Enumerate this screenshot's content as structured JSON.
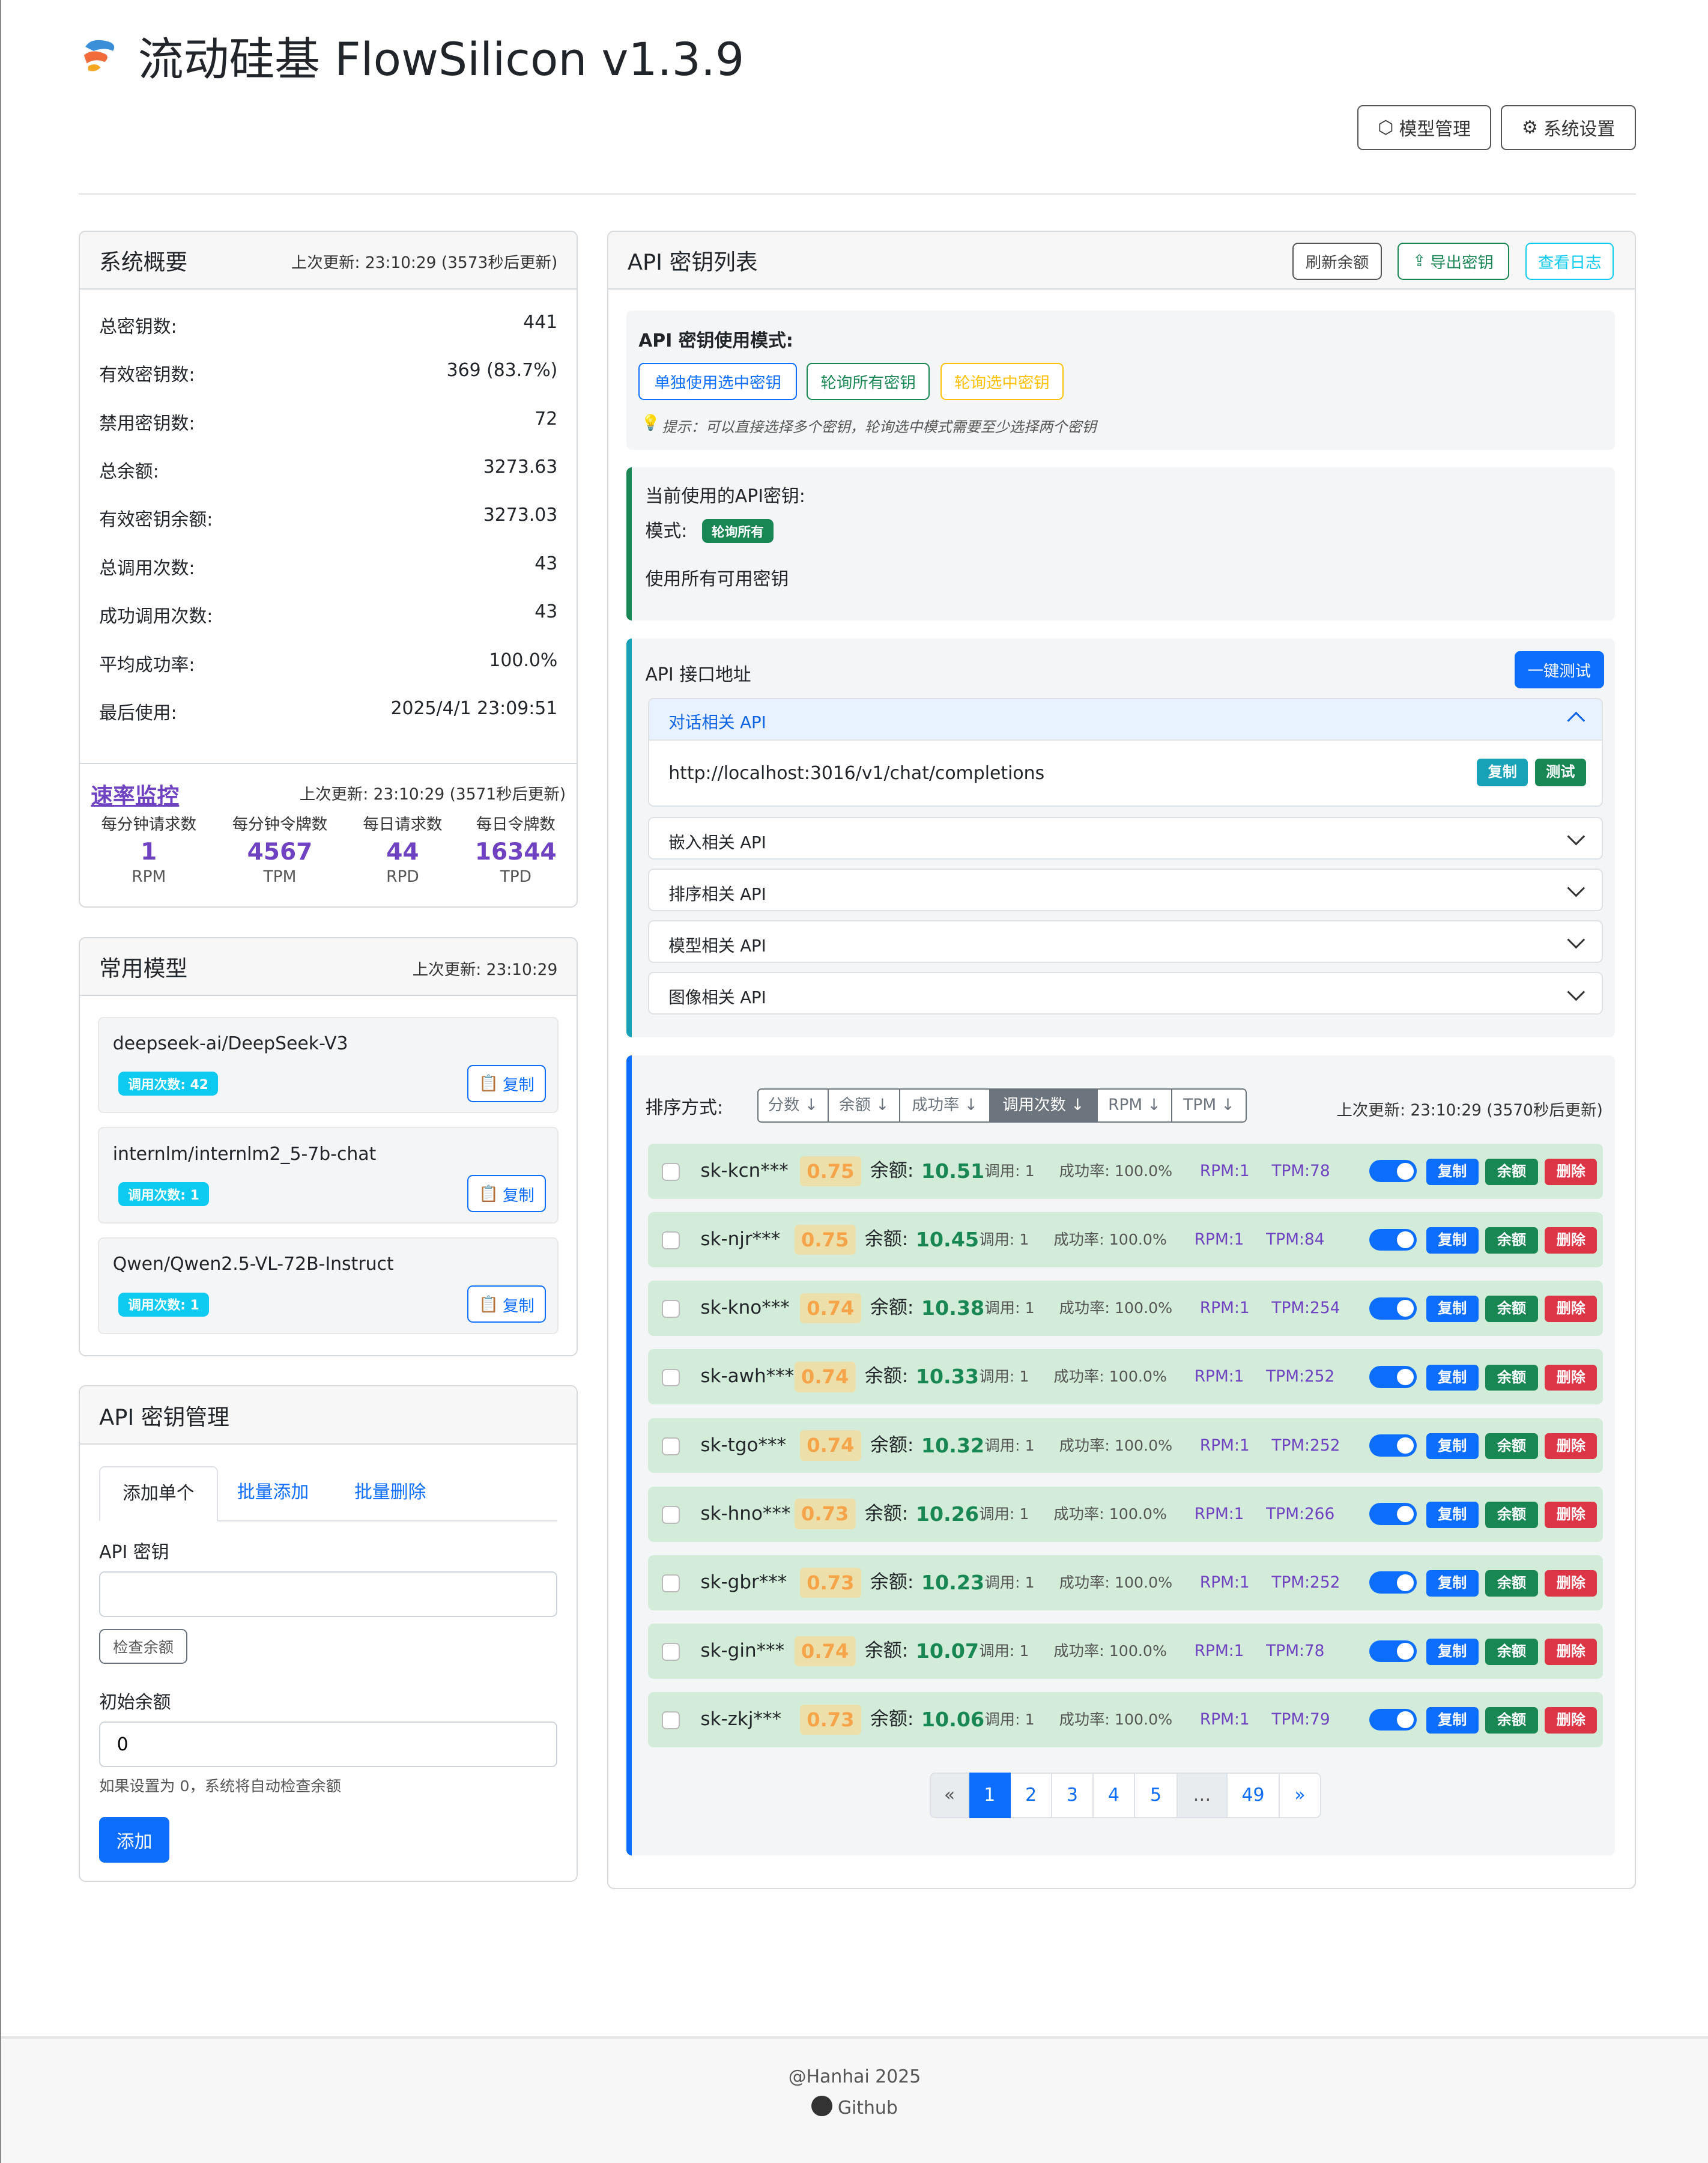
{
  "app": {
    "title": "流动硅基 FlowSilicon v1.3.9",
    "buttons": {
      "models": "模型管理",
      "settings": "系统设置"
    }
  },
  "overview": {
    "title": "系统概要",
    "updated": "上次更新: 23:10:29 (3573秒后更新)",
    "stats": [
      {
        "label": "总密钥数:",
        "value": "441"
      },
      {
        "label": "有效密钥数:",
        "value": "369 (83.7%)"
      },
      {
        "label": "禁用密钥数:",
        "value": "72"
      },
      {
        "label": "总余额:",
        "value": "3273.63"
      },
      {
        "label": "有效密钥余额:",
        "value": "3273.03"
      },
      {
        "label": "总调用次数:",
        "value": "43"
      },
      {
        "label": "成功调用次数:",
        "value": "43"
      },
      {
        "label": "平均成功率:",
        "value": "100.0%"
      },
      {
        "label": "最后使用:",
        "value": "2025/4/1 23:09:51"
      }
    ],
    "rate": {
      "title": "速率监控",
      "updated": "上次更新: 23:10:29 (3571秒后更新)",
      "items": [
        {
          "label": "每分钟请求数",
          "value": "1",
          "unit": "RPM"
        },
        {
          "label": "每分钟令牌数",
          "value": "4567",
          "unit": "TPM"
        },
        {
          "label": "每日请求数",
          "value": "44",
          "unit": "RPD"
        },
        {
          "label": "每日令牌数",
          "value": "16344",
          "unit": "TPD"
        }
      ]
    }
  },
  "models": {
    "title": "常用模型",
    "updated": "上次更新: 23:10:29",
    "copy": "复制",
    "items": [
      {
        "name": "deepseek-ai/DeepSeek-V3",
        "count": "调用次数: 42"
      },
      {
        "name": "internlm/internlm2_5-7b-chat",
        "count": "调用次数: 1"
      },
      {
        "name": "Qwen/Qwen2.5-VL-72B-Instruct",
        "count": "调用次数: 1"
      }
    ]
  },
  "keymgmt": {
    "title": "API 密钥管理",
    "tabs": [
      "添加单个",
      "批量添加",
      "批量删除"
    ],
    "key_label": "API 密钥",
    "key_value": "",
    "check": "检查余额",
    "balance_label": "初始余额",
    "balance_value": "0",
    "hint": "如果设置为 0，系统将自动检查余额",
    "add": "添加"
  },
  "keylist": {
    "title": "API 密钥列表",
    "buttons": {
      "refresh": "刷新余额",
      "export": "导出密钥",
      "logs": "查看日志"
    },
    "mode": {
      "title": "API 密钥使用模式:",
      "options": [
        "单独使用选中密钥",
        "轮询所有密钥",
        "轮询选中密钥"
      ],
      "tip": "提示：可以直接选择多个密钥，轮询选中模式需要至少选择两个密钥"
    },
    "current": {
      "title": "当前使用的API密钥:",
      "mode_label": "模式:",
      "mode_badge": "轮询所有",
      "desc": "使用所有可用密钥"
    },
    "endpoints": {
      "title": "API 接口地址",
      "test_all": "一键测试",
      "open": {
        "label": "对话相关 API",
        "url": "http://localhost:3016/v1/chat/completions",
        "copy": "复制",
        "test": "测试"
      },
      "collapsed": [
        "嵌入相关 API",
        "排序相关 API",
        "模型相关 API",
        "图像相关 API"
      ]
    },
    "sort": {
      "label": "排序方式:",
      "options": [
        "分数 ↓",
        "余额 ↓",
        "成功率 ↓",
        "调用次数 ↓",
        "RPM ↓",
        "TPM ↓"
      ],
      "active": 3,
      "updated": "上次更新: 23:10:29 (3570秒后更新)"
    },
    "row_labels": {
      "balance": "余额:",
      "copy": "复制",
      "balance_btn": "余额",
      "delete": "删除"
    },
    "keys": [
      {
        "key": "sk-kcn***",
        "score": "0.75",
        "balance": "10.51",
        "calls": "调用: 1",
        "success": "成功率: 100.0%",
        "rpm": "RPM:1",
        "tpm": "TPM:78"
      },
      {
        "key": "sk-njr***",
        "score": "0.75",
        "balance": "10.45",
        "calls": "调用: 1",
        "success": "成功率: 100.0%",
        "rpm": "RPM:1",
        "tpm": "TPM:84"
      },
      {
        "key": "sk-kno***",
        "score": "0.74",
        "balance": "10.38",
        "calls": "调用: 1",
        "success": "成功率: 100.0%",
        "rpm": "RPM:1",
        "tpm": "TPM:254"
      },
      {
        "key": "sk-awh***",
        "score": "0.74",
        "balance": "10.33",
        "calls": "调用: 1",
        "success": "成功率: 100.0%",
        "rpm": "RPM:1",
        "tpm": "TPM:252"
      },
      {
        "key": "sk-tgo***",
        "score": "0.74",
        "balance": "10.32",
        "calls": "调用: 1",
        "success": "成功率: 100.0%",
        "rpm": "RPM:1",
        "tpm": "TPM:252"
      },
      {
        "key": "sk-hno***",
        "score": "0.73",
        "balance": "10.26",
        "calls": "调用: 1",
        "success": "成功率: 100.0%",
        "rpm": "RPM:1",
        "tpm": "TPM:266"
      },
      {
        "key": "sk-gbr***",
        "score": "0.73",
        "balance": "10.23",
        "calls": "调用: 1",
        "success": "成功率: 100.0%",
        "rpm": "RPM:1",
        "tpm": "TPM:252"
      },
      {
        "key": "sk-gin***",
        "score": "0.74",
        "balance": "10.07",
        "calls": "调用: 1",
        "success": "成功率: 100.0%",
        "rpm": "RPM:1",
        "tpm": "TPM:78"
      },
      {
        "key": "sk-zkj***",
        "score": "0.73",
        "balance": "10.06",
        "calls": "调用: 1",
        "success": "成功率: 100.0%",
        "rpm": "RPM:1",
        "tpm": "TPM:79"
      }
    ],
    "pagination": [
      "«",
      "1",
      "2",
      "3",
      "4",
      "5",
      "…",
      "49",
      "»"
    ]
  },
  "footer": {
    "copyright": "@Hanhai 2025",
    "github": "Github"
  }
}
